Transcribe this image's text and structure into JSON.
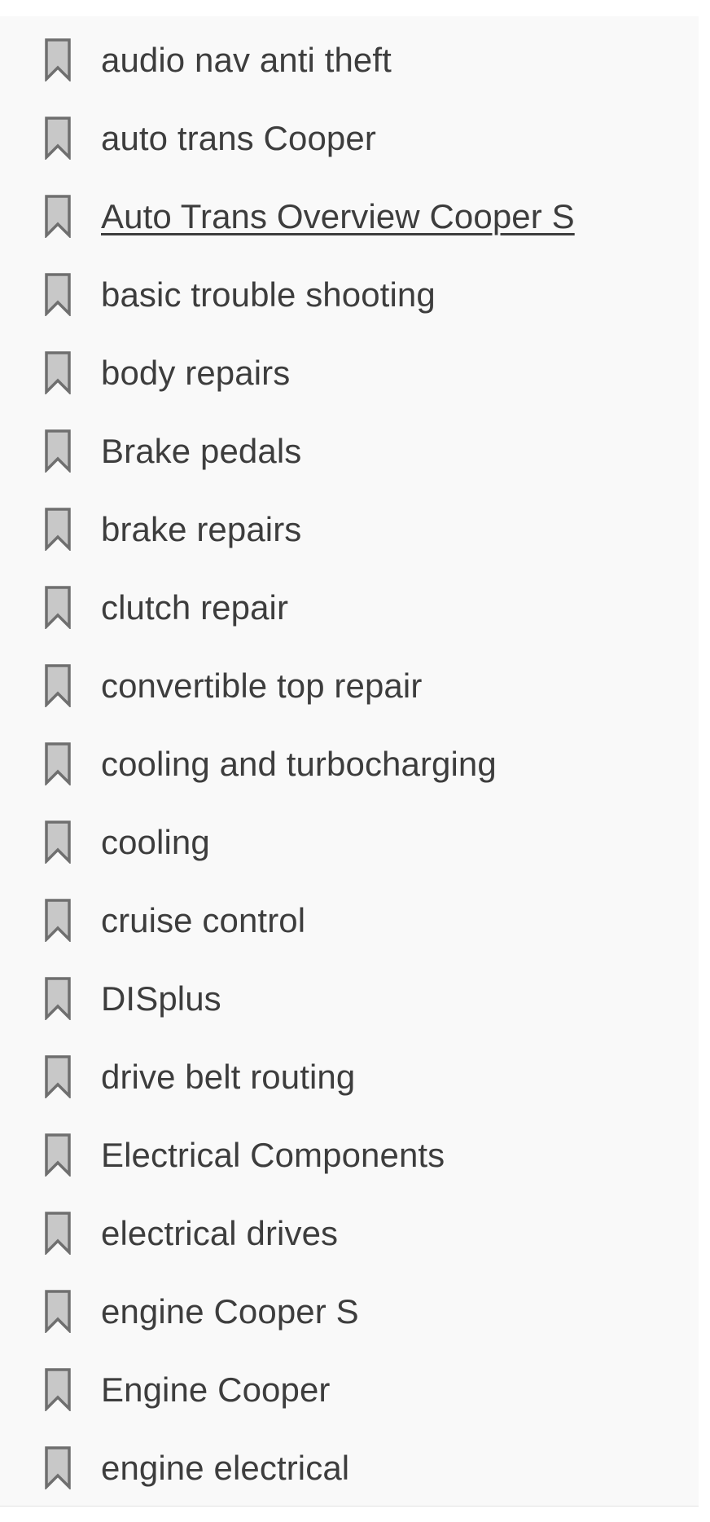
{
  "bookmarks": {
    "icon": "bookmark-icon",
    "icon_fill": "#c8c8c8",
    "icon_stroke": "#6f6f6f",
    "text_color": "#3d3d3d",
    "hovered_index": 2,
    "items": [
      {
        "label": "audio nav anti theft"
      },
      {
        "label": "auto trans Cooper"
      },
      {
        "label": "Auto Trans Overview Cooper S"
      },
      {
        "label": "basic trouble shooting"
      },
      {
        "label": "body repairs"
      },
      {
        "label": "Brake pedals"
      },
      {
        "label": "brake repairs"
      },
      {
        "label": "clutch repair"
      },
      {
        "label": "convertible top repair"
      },
      {
        "label": "cooling and turbocharging"
      },
      {
        "label": "cooling"
      },
      {
        "label": "cruise control"
      },
      {
        "label": "DISplus"
      },
      {
        "label": "drive belt routing"
      },
      {
        "label": "Electrical Components"
      },
      {
        "label": "electrical drives"
      },
      {
        "label": "engine Cooper S"
      },
      {
        "label": "Engine Cooper"
      },
      {
        "label": "engine electrical"
      }
    ]
  }
}
